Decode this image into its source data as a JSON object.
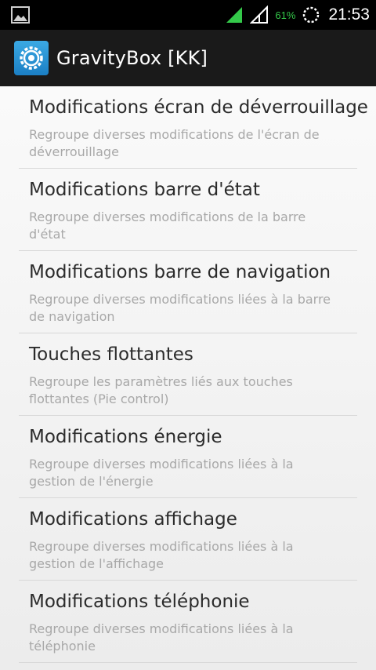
{
  "status_bar": {
    "battery_percent": "61%",
    "time": "21:53",
    "icons": [
      "gallery-icon",
      "signal-green-icon",
      "signal-empty-icon",
      "sync-ring-icon"
    ],
    "battery_color": "#34c94a"
  },
  "action_bar": {
    "title": "GravityBox [KK]",
    "icon": "gear-icon",
    "accent": "#1b7fc4"
  },
  "items": [
    {
      "title": "Modifications écran de déverrouillage",
      "summary": "Regroupe diverses modifications de l'écran de déverrouillage"
    },
    {
      "title": "Modifications barre d'état",
      "summary": "Regroupe diverses modifications de la barre d'état"
    },
    {
      "title": "Modifications barre de navigation",
      "summary": "Regroupe diverses modifications liées à la barre de navigation"
    },
    {
      "title": "Touches flottantes",
      "summary": "Regroupe les paramètres liés aux touches flottantes (Pie control)"
    },
    {
      "title": "Modifications énergie",
      "summary": "Regroupe diverses modifications liées à la gestion de l'énergie"
    },
    {
      "title": "Modifications affichage",
      "summary": "Regroupe diverses modifications liées à la gestion de l'affichage"
    },
    {
      "title": "Modifications téléphonie",
      "summary": "Regroupe diverses modifications liées à la téléphonie"
    }
  ]
}
